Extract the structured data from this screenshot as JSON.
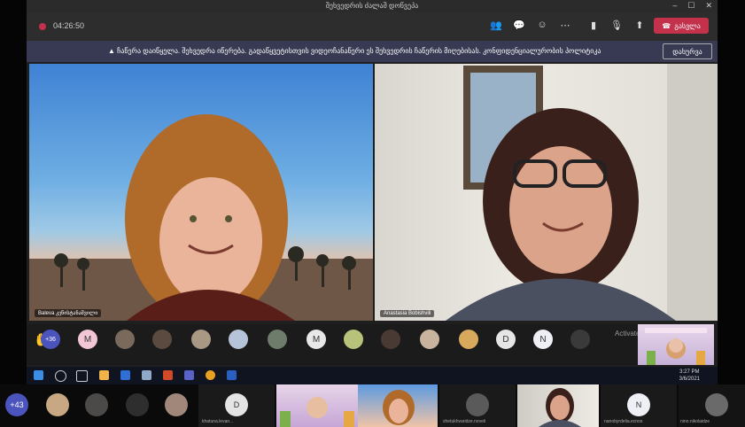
{
  "window": {
    "title": "შეხვედრის ძალაშ დოწვეპა",
    "controls": [
      "–",
      "☐",
      "✕"
    ]
  },
  "meeting": {
    "timer": "04:26:50",
    "leave_label": "გასვლა"
  },
  "banner": {
    "text": "▲ ჩაწერა დაიწყელა. შეხვედრა იწერება. გადაწყვეტისთვის ვიდეოჩანაწერი ეს შეხვედრის ჩაწერის მიღებისას. კონფიდენციალურობის პოლიტიკა",
    "dismiss_label": "დახურვა"
  },
  "videos": {
    "left_name": "Baleva კეწისტანაშვილი",
    "right_name": "Anastasia Bobishvili"
  },
  "participants_row": {
    "overflow_count": "+36",
    "initials": [
      "M",
      "M",
      "D",
      "N"
    ]
  },
  "watermark": "Activate Wi",
  "taskbar": {
    "time": "3:27 PM",
    "date": "3/6/2021"
  },
  "bottom_row": {
    "overflow_count": "+43",
    "d_initial": "D",
    "n_initial": "N",
    "names": [
      "khatuna.levan...",
      "shetukhvaridze.noveli",
      "nanobyrdelia.ecnos",
      "nino.nikolaidze"
    ]
  },
  "colors": {
    "leave": "#c4314b",
    "banner": "#373a52",
    "background": "#1f1f1f"
  }
}
